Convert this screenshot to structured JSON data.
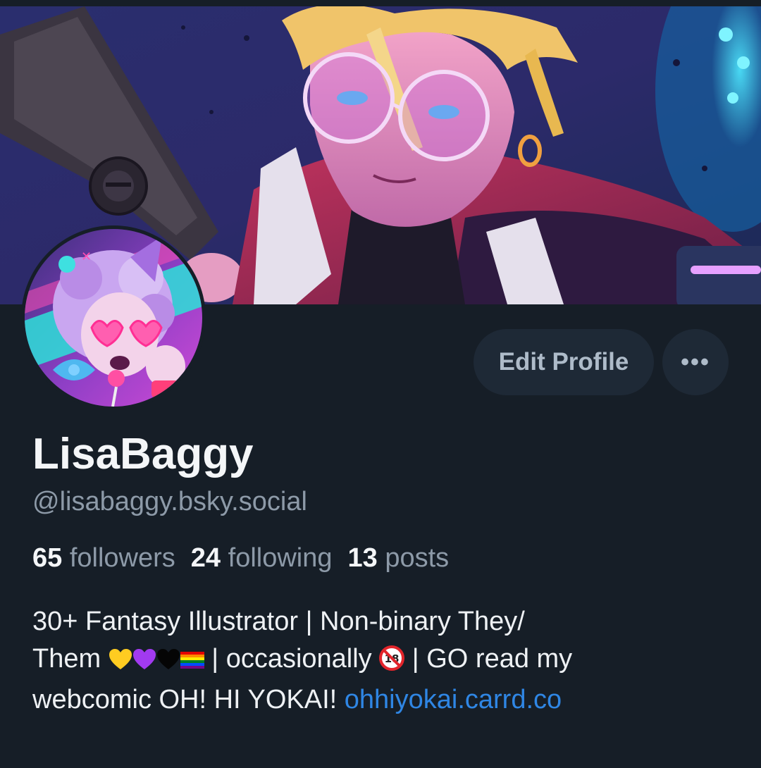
{
  "profile": {
    "display_name": "LisaBaggy",
    "handle": "@lisabaggy.bsky.social",
    "stats": {
      "followers_count": "65",
      "followers_label": "followers",
      "following_count": "24",
      "following_label": "following",
      "posts_count": "13",
      "posts_label": "posts"
    },
    "bio": {
      "line1": "30+ Fantasy Illustrator | Non-binary They/",
      "line2_start": "Them",
      "line2_mid": " | occasionally ",
      "line2_end": " | GO read my",
      "line3_start": "webcomic OH! HI YOKAI! ",
      "link": "ohhiyokai.carrd.co"
    },
    "bio_emoji": [
      "yellow-heart-icon",
      "purple-heart-icon",
      "black-heart-icon",
      "rainbow-flag-icon",
      "no-under-18-icon"
    ]
  },
  "actions": {
    "edit_profile_label": "Edit Profile",
    "more_label": "•••"
  },
  "colors": {
    "background": "#161e27",
    "button_bg": "#1e2936",
    "button_text": "#aebbc9",
    "muted_text": "#8d9aa8",
    "link": "#2f86e4"
  }
}
